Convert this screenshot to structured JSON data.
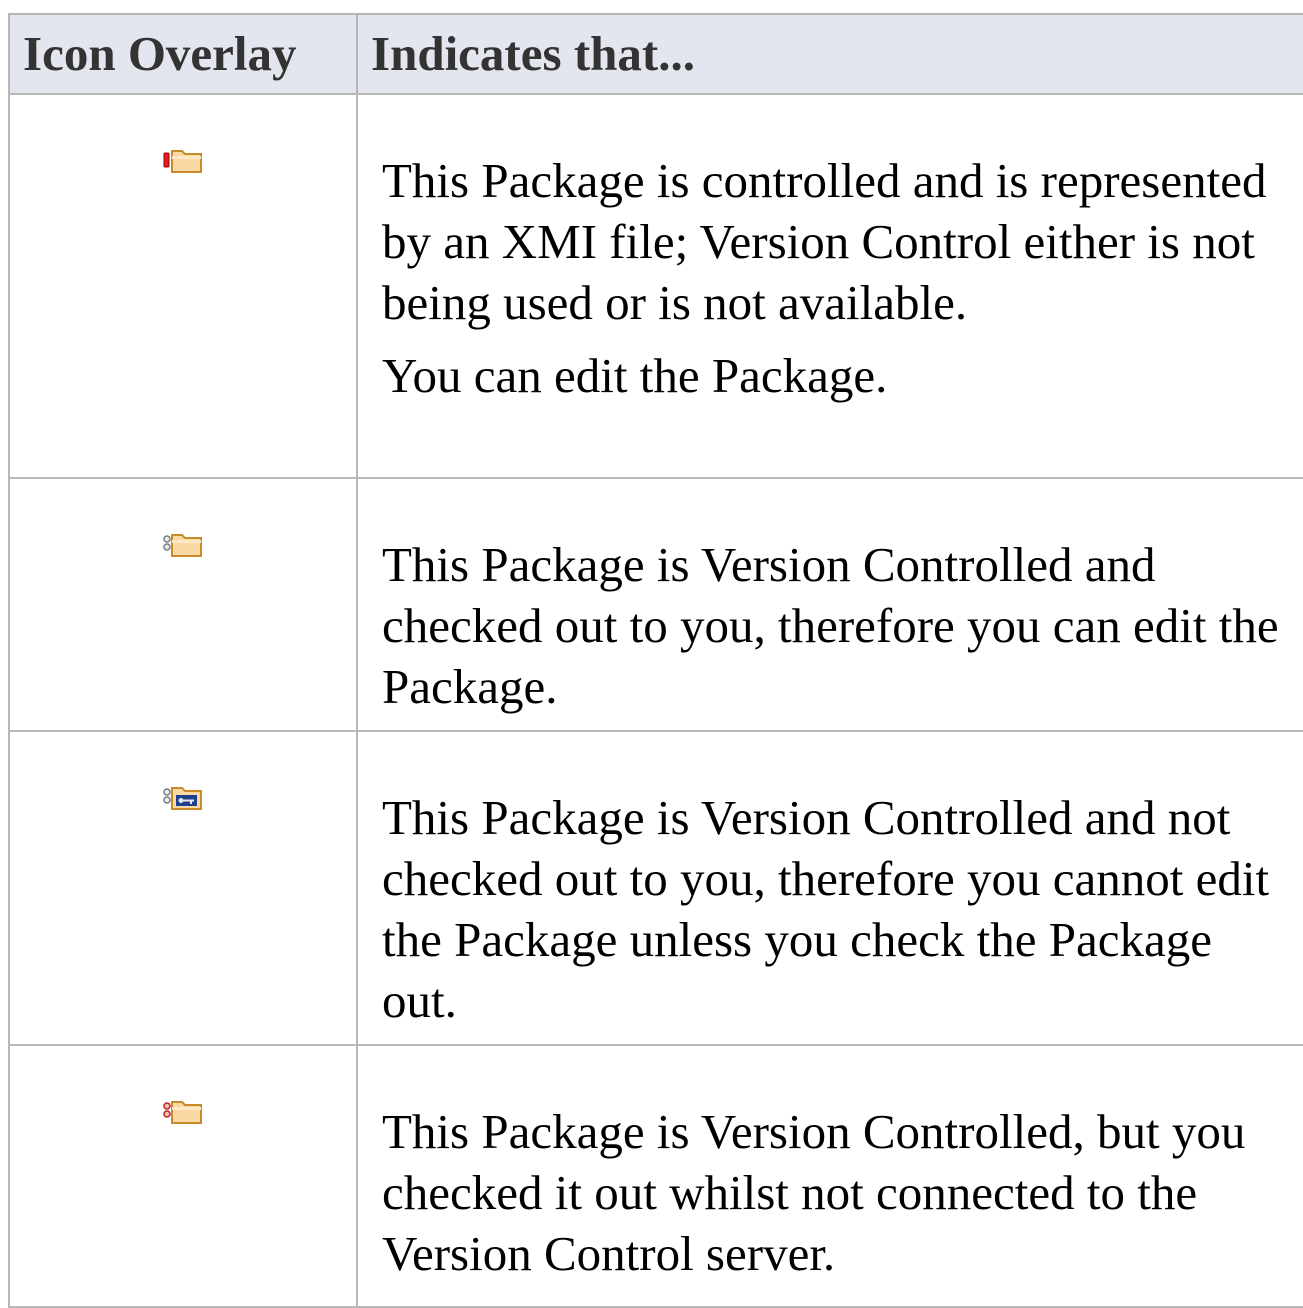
{
  "table": {
    "headers": {
      "icon_overlay": "Icon Overlay",
      "indicates": "Indicates that..."
    },
    "rows": [
      {
        "icon": "package-controlled-xmi-icon",
        "text": "This Package is controlled and is represented by an XMI file; Version Control either is not being used or is not available.",
        "text2": "You can edit the Package."
      },
      {
        "icon": "package-checked-out-icon",
        "text": "This Package is Version Controlled and checked out to you, therefore you can edit the Package."
      },
      {
        "icon": "package-locked-icon",
        "text": "This Package is Version Controlled and not checked out to you, therefore you cannot edit the Package unless you check the Package out."
      },
      {
        "icon": "package-offline-checkout-icon",
        "text": "This Package is Version Controlled, but you checked it out whilst not connected to the Version Control server."
      }
    ]
  },
  "colors": {
    "header_bg": "#e3e6ee",
    "border": "#b7b7b7",
    "folder_fill": "#fbd9a4",
    "folder_stroke": "#c98a2a"
  }
}
